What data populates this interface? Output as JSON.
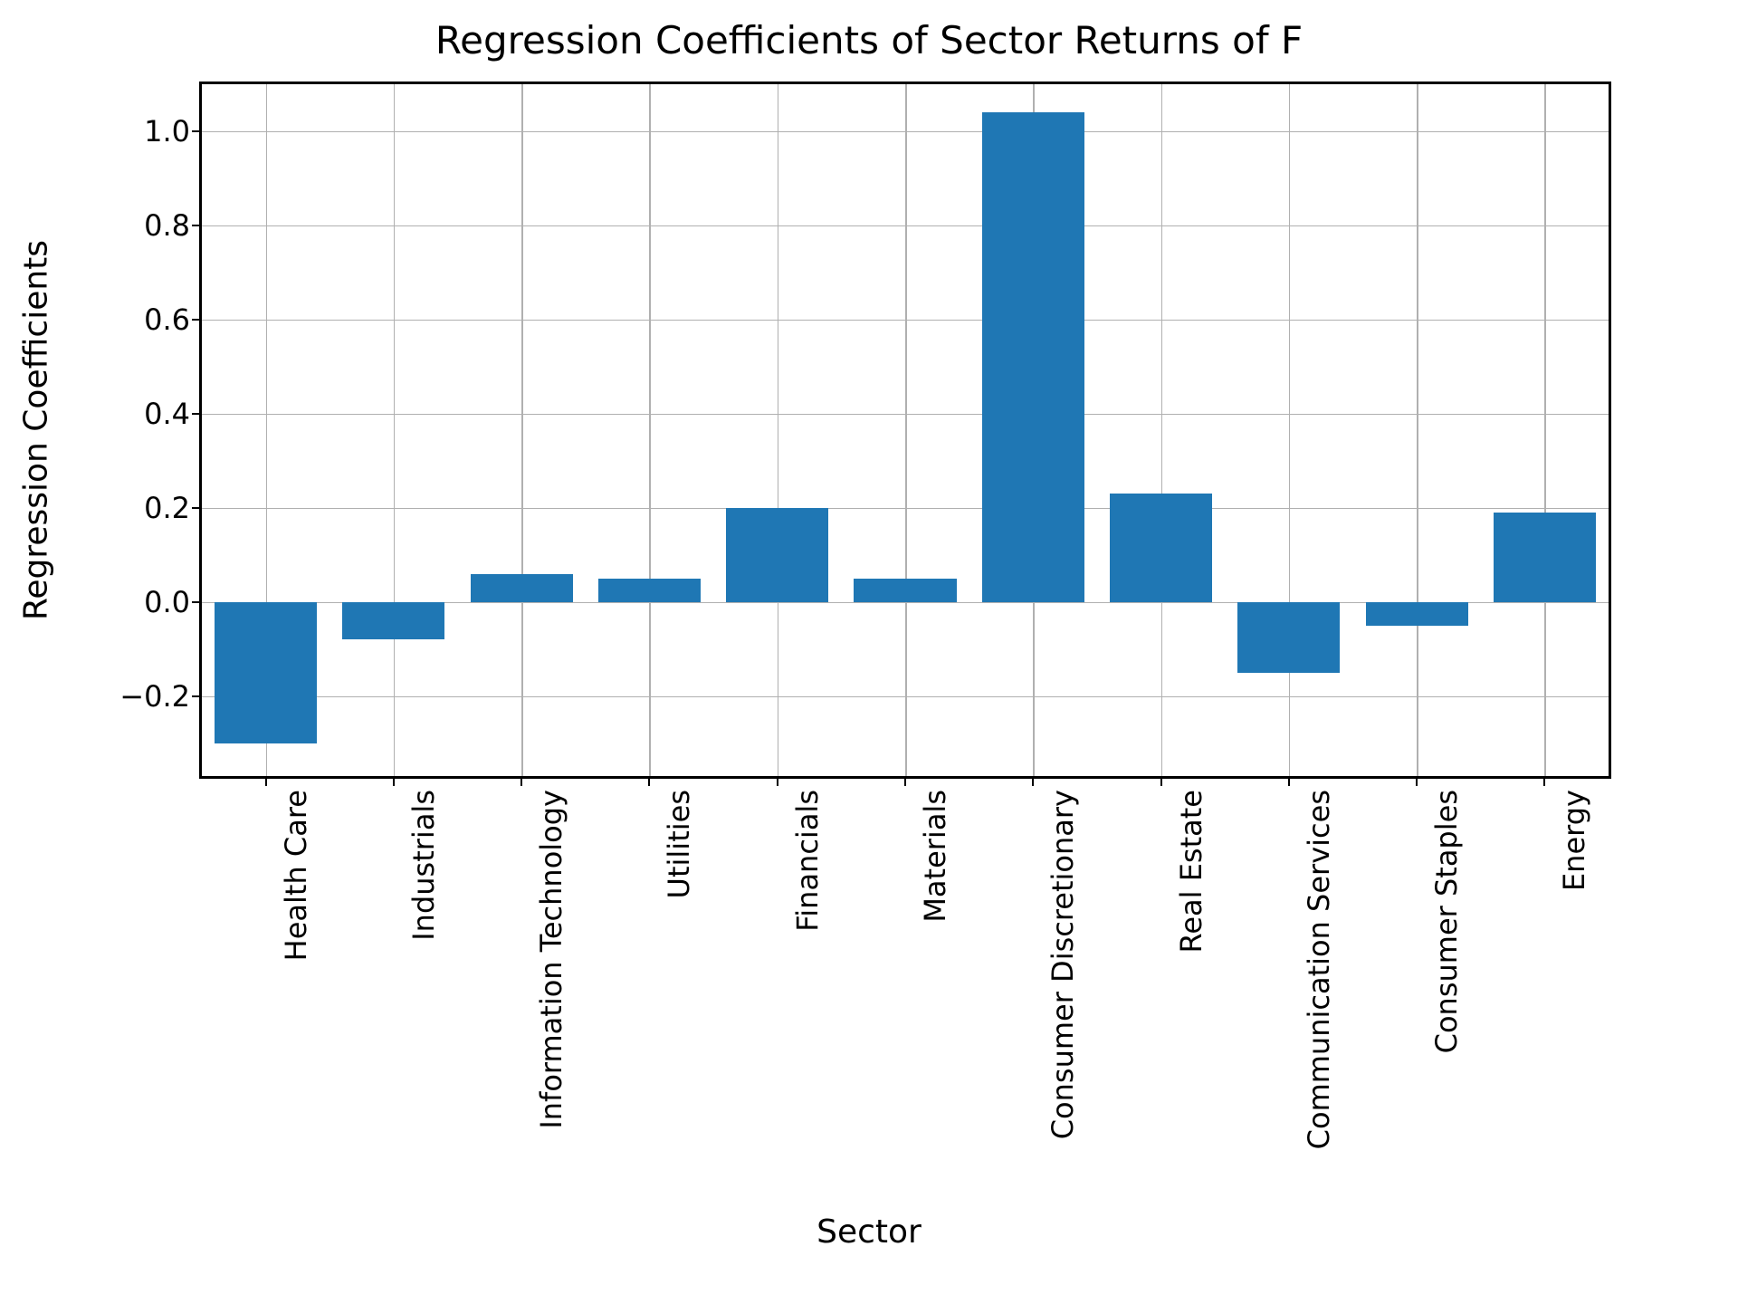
{
  "chart_data": {
    "type": "bar",
    "title": "Regression Coefficients of Sector Returns of F",
    "xlabel": "Sector",
    "ylabel": "Regression Coefficients",
    "categories": [
      "Health Care",
      "Industrials",
      "Information Technology",
      "Utilities",
      "Financials",
      "Materials",
      "Consumer Discretionary",
      "Real Estate",
      "Communication Services",
      "Consumer Staples",
      "Energy"
    ],
    "values": [
      -0.3,
      -0.08,
      0.06,
      0.05,
      0.2,
      0.05,
      1.04,
      0.23,
      -0.15,
      -0.05,
      0.19
    ],
    "ylim": [
      -0.37,
      1.1
    ],
    "y_ticks": [
      -0.2,
      0.0,
      0.2,
      0.4,
      0.6,
      0.8,
      1.0
    ],
    "y_tick_labels": [
      "−0.2",
      "0.0",
      "0.2",
      "0.4",
      "0.6",
      "0.8",
      "1.0"
    ],
    "bar_color": "#1f77b4"
  }
}
